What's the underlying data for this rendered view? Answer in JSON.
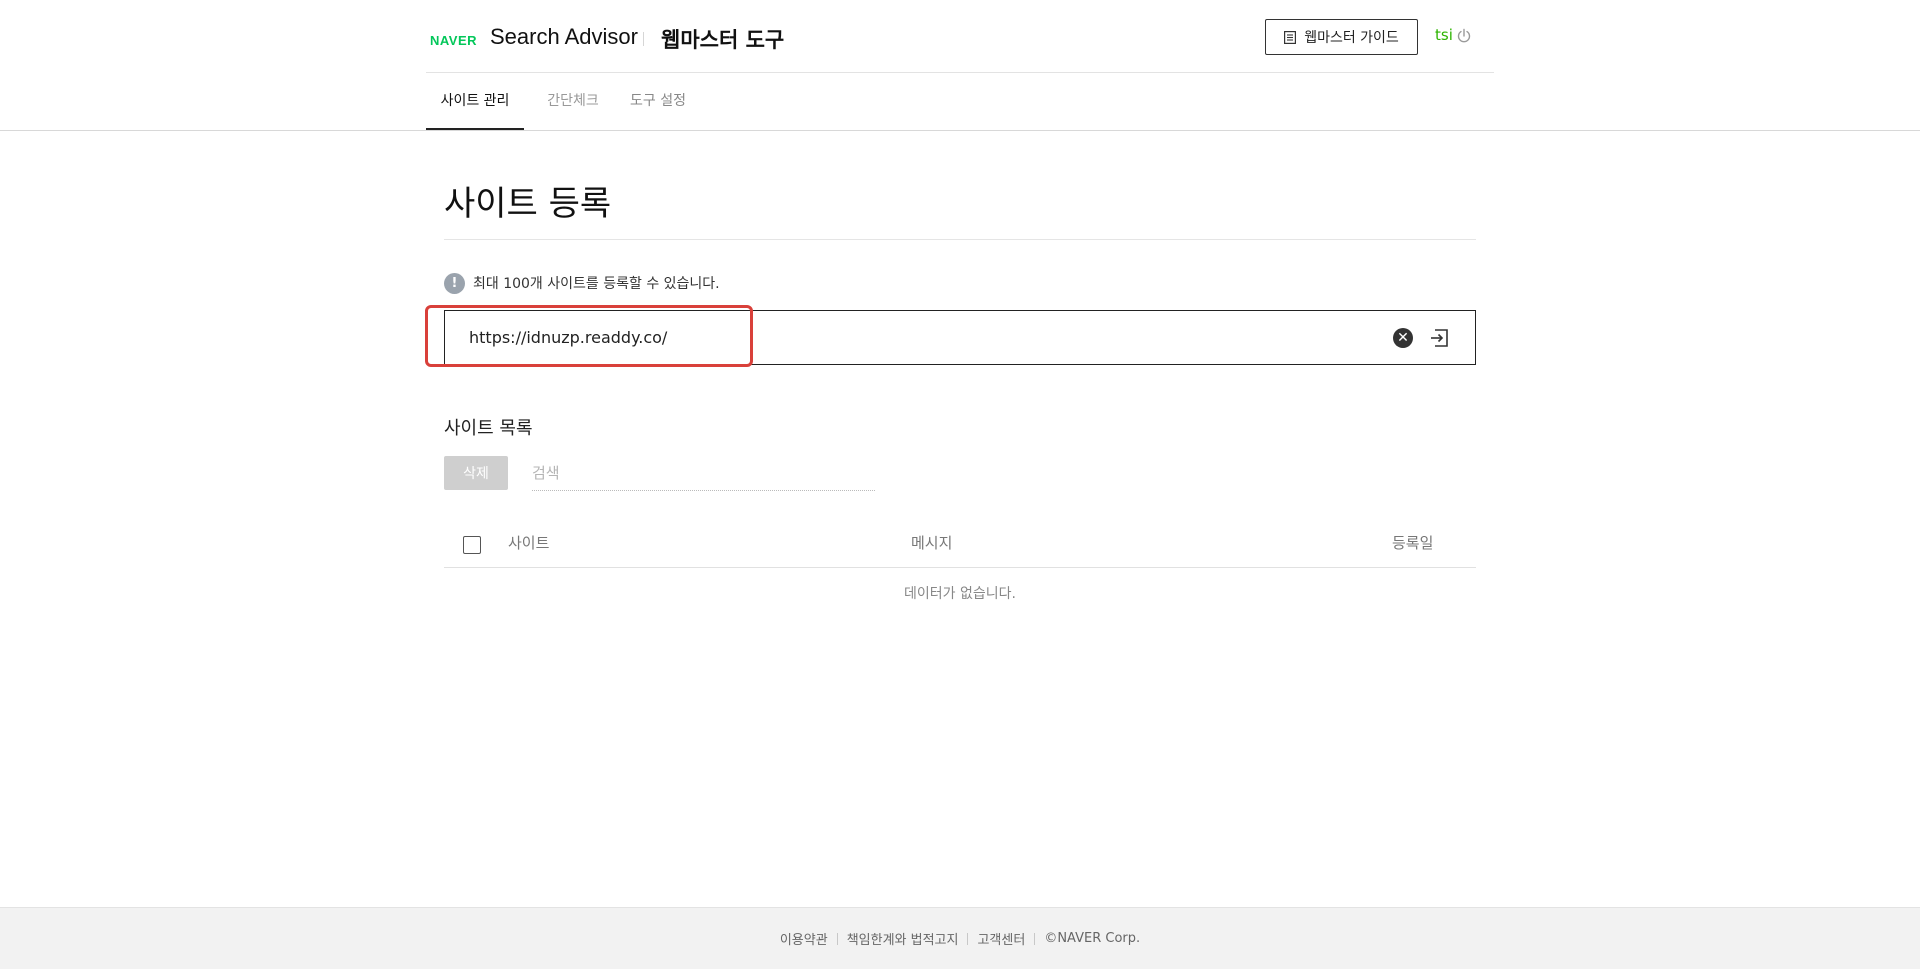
{
  "header": {
    "brand": "NAVER",
    "app_title": "Search Advisor",
    "app_subtitle": "웹마스터 도구",
    "guide_button": "웹마스터 가이드",
    "user": "tsi",
    "icons": {
      "guide": "document-list-icon",
      "logout": "power-icon"
    }
  },
  "tabs": [
    {
      "label": "사이트 관리",
      "active": true
    },
    {
      "label": "간단체크",
      "active": false
    },
    {
      "label": "도구 설정",
      "active": false
    }
  ],
  "main": {
    "title": "사이트 등록",
    "notice": "최대 100개 사이트를 등록할 수 있습니다.",
    "url_input": {
      "value": "https://idnuzp.readdy.co/"
    },
    "list_title": "사이트 목록",
    "delete_button": "삭제",
    "search_placeholder": "검색",
    "table": {
      "columns": [
        "사이트",
        "메시지",
        "등록일"
      ],
      "empty_text": "데이터가 없습니다."
    },
    "colors": {
      "highlight": "#d9403a",
      "brand": "#03c75a",
      "user": "#2db400"
    }
  },
  "footer": {
    "links": [
      "이용약관",
      "책임한계와 법적고지",
      "고객센터"
    ],
    "copyright": "©NAVER Corp."
  }
}
